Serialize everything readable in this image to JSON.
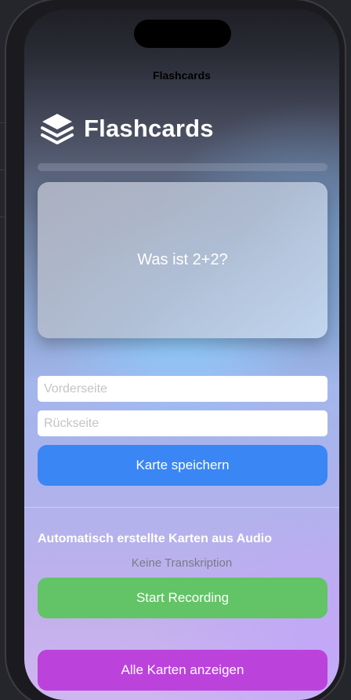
{
  "nav": {
    "title": "Flashcards"
  },
  "header": {
    "title": "Flashcards",
    "icon": "stack-layers-icon"
  },
  "progress": {
    "value": 0
  },
  "card": {
    "question": "Was ist 2+2?"
  },
  "form": {
    "front_placeholder": "Vorderseite",
    "front_value": "",
    "back_placeholder": "Rückseite",
    "back_value": "",
    "save_label": "Karte speichern"
  },
  "audio": {
    "section_title": "Automatisch erstellte Karten aus Audio",
    "transcript_status": "Keine Transkription",
    "record_label": "Start Recording"
  },
  "footer": {
    "show_all_label": "Alle Karten anzeigen"
  },
  "colors": {
    "save_button": "#3a86f5",
    "record_button": "#62c466",
    "show_all_button": "#bc42dc"
  }
}
